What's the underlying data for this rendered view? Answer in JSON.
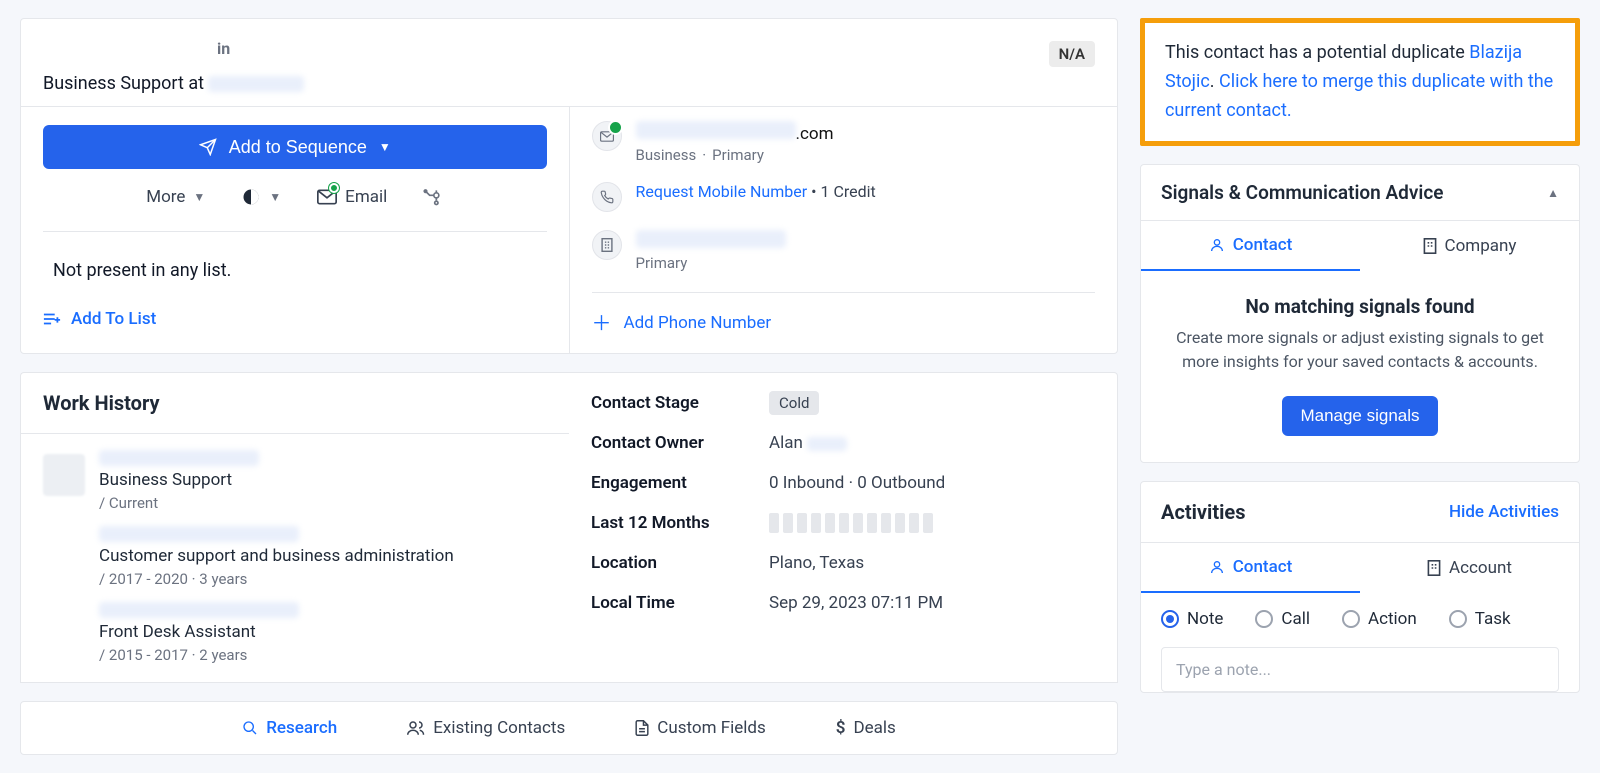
{
  "header": {
    "subtitle_prefix": "Business Support at ",
    "badge": "N/A"
  },
  "actions": {
    "sequence_label": "Add to Sequence",
    "more_label": "More",
    "email_label": "Email"
  },
  "list": {
    "status": "Not present in any list.",
    "add_label": "Add To List"
  },
  "contact_info": {
    "email_domain": ".com",
    "email_tags": "Business",
    "email_tags_sep": " · ",
    "email_primary": "Primary",
    "request_mobile": "Request Mobile Number",
    "credit_suffix": " • 1 Credit",
    "company_primary": "Primary",
    "add_phone": "Add Phone Number"
  },
  "work": {
    "title": "Work History",
    "items": [
      {
        "title": "Business Support",
        "meta": "/ Current"
      },
      {
        "title": "Customer support and business administration",
        "meta": "/ 2017 - 2020 · 3 years"
      },
      {
        "title": "Front Desk Assistant",
        "meta": "/ 2015 - 2017 · 2 years"
      }
    ]
  },
  "details": {
    "stage_k": "Contact Stage",
    "stage_v": "Cold",
    "owner_k": "Contact Owner",
    "owner_v": "Alan ",
    "engagement_k": "Engagement",
    "engagement_v": "0 Inbound · 0 Outbound",
    "last12_k": "Last 12 Months",
    "location_k": "Location",
    "location_v": "Plano, Texas",
    "localtime_k": "Local Time",
    "localtime_v": "Sep 29, 2023 07:11 PM"
  },
  "bottom_tabs": {
    "research": "Research",
    "existing": "Existing Contacts",
    "custom": "Custom Fields",
    "deals": "Deals"
  },
  "duplicate": {
    "prefix": "This contact has a potential duplicate ",
    "name": "Blazija Stojic",
    "period": ". ",
    "link": "Click here to merge this duplicate with the current contact."
  },
  "signals": {
    "title": "Signals & Communication Advice",
    "tab_contact": "Contact",
    "tab_company": "Company",
    "empty_title": "No matching signals found",
    "empty_body": "Create more signals or adjust existing signals to get more insights for your saved contacts & accounts.",
    "manage": "Manage signals"
  },
  "activities": {
    "title": "Activities",
    "hide": "Hide Activities",
    "tab_contact": "Contact",
    "tab_account": "Account",
    "types": {
      "note": "Note",
      "call": "Call",
      "action": "Action",
      "task": "Task"
    },
    "placeholder": "Type a note..."
  }
}
